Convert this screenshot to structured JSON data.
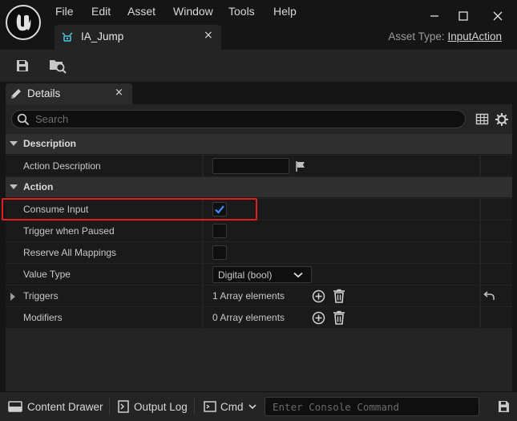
{
  "menu": [
    "File",
    "Edit",
    "Asset",
    "Window",
    "Tools",
    "Help"
  ],
  "window_controls": {
    "minimize_icon": "minimize-icon",
    "maximize_icon": "maximize-icon",
    "close_icon": "close-icon"
  },
  "asset_tab": {
    "label": "IA_Jump",
    "close": "×"
  },
  "asset_type": {
    "label": "Asset Type:",
    "value": "InputAction"
  },
  "details_tab": {
    "label": "Details",
    "close": "×"
  },
  "search": {
    "placeholder": "Search"
  },
  "categories": {
    "description": "Description",
    "action": "Action"
  },
  "properties": {
    "action_description": {
      "label": "Action Description",
      "value": ""
    },
    "consume_input": {
      "label": "Consume Input",
      "checked": true
    },
    "trigger_when_paused": {
      "label": "Trigger when Paused",
      "checked": false
    },
    "reserve_all_mappings": {
      "label": "Reserve All Mappings",
      "checked": false
    },
    "value_type": {
      "label": "Value Type",
      "value": "Digital (bool)"
    },
    "triggers": {
      "label": "Triggers",
      "value": "1 Array elements"
    },
    "modifiers": {
      "label": "Modifiers",
      "value": "0 Array elements"
    }
  },
  "statusbar": {
    "content_drawer": "Content Drawer",
    "output_log": "Output Log",
    "cmd": "Cmd",
    "console_placeholder": "Enter Console Command"
  },
  "colors": {
    "highlight": "#e02020",
    "checkbox_check": "#3d8bff"
  }
}
